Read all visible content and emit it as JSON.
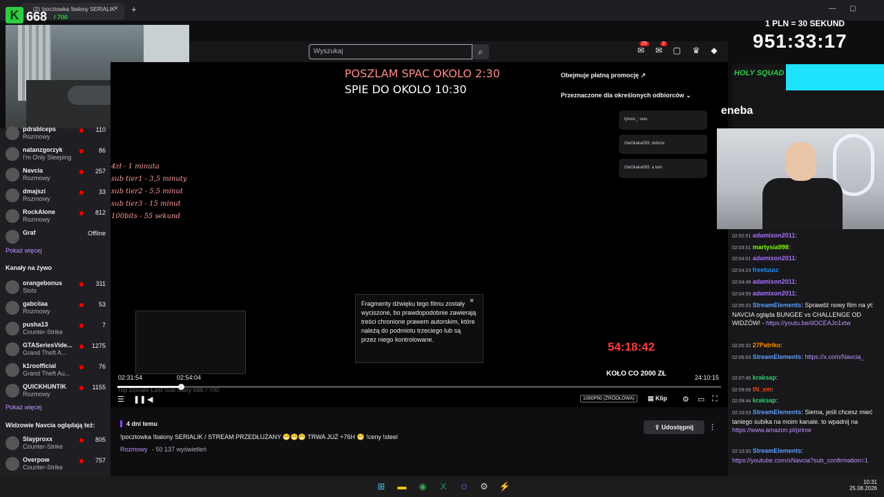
{
  "browser": {
    "tab_title": "(2) !pocztowka !balony SERIALIK",
    "tab_close": "×",
    "new_tab": "+"
  },
  "overlay": {
    "sub_count": "668",
    "sub_goal": "/ 700",
    "pln_rate": "1 PLN = 30 SEKUND",
    "big_timer": "951:33:17",
    "sleep_line1": "POSZLAM SPAC OKOLO 2:30",
    "sleep_line2": "SPIE DO OKOLO 10:30",
    "pricing": [
      "4zł - 1 minuta",
      "sub tier1 - 3,5 minuty",
      "sub tier2 - 5,5 minut",
      "sub tier3 - 15 minut",
      "100bits - 55 sekund"
    ],
    "countdown": "54:18:42",
    "kolo": "KOŁO CO 2000 ZŁ",
    "eneba": "eneba",
    "hs_logo": "HOLY SQUAD"
  },
  "topbar": {
    "search_placeholder": "Wyszukaj",
    "notif_count": "25",
    "msg_count": "2"
  },
  "sidebar": {
    "top_channels": [
      {
        "name": "pdrablceps",
        "game": "Rozmowy",
        "viewers": "110"
      },
      {
        "name": "natanzgorzyk",
        "game": "I'm Only Sleeping",
        "viewers": "86"
      },
      {
        "name": "Navcia",
        "game": "Rozmowy",
        "viewers": "257"
      },
      {
        "name": "dmajszi",
        "game": "Rozmowy",
        "viewers": "33"
      },
      {
        "name": "RockAlone",
        "game": "Rozmowy",
        "viewers": "812"
      },
      {
        "name": "Graf",
        "game": "",
        "viewers": "Offline"
      }
    ],
    "show_more_1": "Pokaż więcej",
    "live_heading": "Kanały na żywo",
    "live_channels": [
      {
        "name": "orangebonus",
        "game": "Slots",
        "viewers": "311"
      },
      {
        "name": "gabciiaa",
        "game": "Rozmowy",
        "viewers": "53"
      },
      {
        "name": "pusha13",
        "game": "Counter-Strike",
        "viewers": "7"
      },
      {
        "name": "GTASeriesVide...",
        "game": "Grand Theft A...",
        "viewers": "1275"
      },
      {
        "name": "k1roofficial",
        "game": "Grand Theft Au...",
        "viewers": "76"
      },
      {
        "name": "QUICKHUNTIK",
        "game": "Rozmowy",
        "viewers": "1155"
      }
    ],
    "show_more_2": "Pokaż więcej",
    "also_heading": "Widzowie Navcia oglądają też:",
    "also_channels": [
      {
        "name": "Slayproxx",
        "game": "Counter-Strike",
        "viewers": "805"
      },
      {
        "name": "Overpow",
        "game": "Counter-Strike",
        "viewers": "757"
      }
    ]
  },
  "player": {
    "promo_paid": "Obejmuje płatną promocję",
    "promo_target": "Przeznaczone dla określonych odbiorców",
    "mini_msgs": [
      "tytoos_: was",
      "OwOkaka093: dobrze",
      "OwOkaka093: a tam"
    ],
    "muted_notice": "Fragmenty dźwięku tego filmu zostały wyciszone, bo prawdopodobnie zawierają treści chronione prawem autorskim, które należą do podmiotu trzeciego lub są przez niego kontrolowane.",
    "muted_close": "×",
    "time_start": "02:31:54",
    "time_hover": "02:54:04",
    "time_end": "24:10:15",
    "ghost_labels": "Top Donate    Last Sub    Suby  686 / 700",
    "progress_fraction": 0.105,
    "quality": "1080P60 (ŹRÓDŁOWA)",
    "clip": "Klip"
  },
  "video": {
    "age": "4 dni temu",
    "title": "!pocztowka !balony SERIALIK / STREAM PRZEDŁUŻANY 😁😁😁 TRWA JUŻ +76H 😁 !ceny !steel",
    "category": "Rozmowy",
    "views": "- 50 137 wyświetleń",
    "share": "Udostępnij",
    "kebab": "⋮"
  },
  "chat": [
    {
      "ts": "02:02:51",
      "user": "adamixon2011",
      "color": "#a970ff",
      "text": ":"
    },
    {
      "ts": "02:03:51",
      "user": "martysia998",
      "color": "#7cfc00",
      "text": ":"
    },
    {
      "ts": "02:04:01",
      "user": "adamixon2011",
      "color": "#a970ff",
      "text": ":"
    },
    {
      "ts": "02:04:23",
      "user": "freetuuu",
      "color": "#1e90ff",
      "text": ":"
    },
    {
      "ts": "02:04:49",
      "user": "adamixon2011",
      "color": "#a970ff",
      "text": ":"
    },
    {
      "ts": "02:04:59",
      "user": "adamixon2011",
      "color": "#a970ff",
      "text": ":"
    },
    {
      "ts": "02:05:03",
      "user": "StreamElements",
      "color": "#5c9dff",
      "text": ": Sprawdź nowy film na yt: NAVCIA ogląda BUNGEE vs CHALLENGE OD WIDZÓW! -",
      "link": "https://youtu.be/dOCEAJo1xtw"
    },
    {
      "ts": "02:05:32",
      "user": "27Patriko",
      "color": "#ff8c00",
      "text": ":"
    },
    {
      "ts": "02:06:03",
      "user": "StreamElements",
      "color": "#5c9dff",
      "text": ":",
      "link": "https://x.com/Navcia_"
    },
    {
      "ts": "02:07:45",
      "user": "kraksap",
      "color": "#2ecc71",
      "text": ":"
    },
    {
      "ts": "02:09:09",
      "user": "tN_xm",
      "color": "#ff4500",
      "text": ":"
    },
    {
      "ts": "02:09:44",
      "user": "kraksap",
      "color": "#2ecc71",
      "text": ":"
    },
    {
      "ts": "02:10:03",
      "user": "StreamElements",
      "color": "#5c9dff",
      "text": ": Siema, jeśli chcesz mieć taniego subika na moim kanale. to wpadnij na",
      "link": "https://www.amazon.pl/prime"
    },
    {
      "ts": "02:10:33",
      "user": "StreamElements",
      "color": "#5c9dff",
      "text": ":",
      "link": "https://youtube.com/xNavcia?sub_confirmation=1"
    }
  ],
  "taskbar": {
    "time": "10:31",
    "date": "25.08.2026"
  },
  "colors": {
    "accent": "#9147ff",
    "live": "#eb0400",
    "overlay_red": "#ff3b3b"
  }
}
